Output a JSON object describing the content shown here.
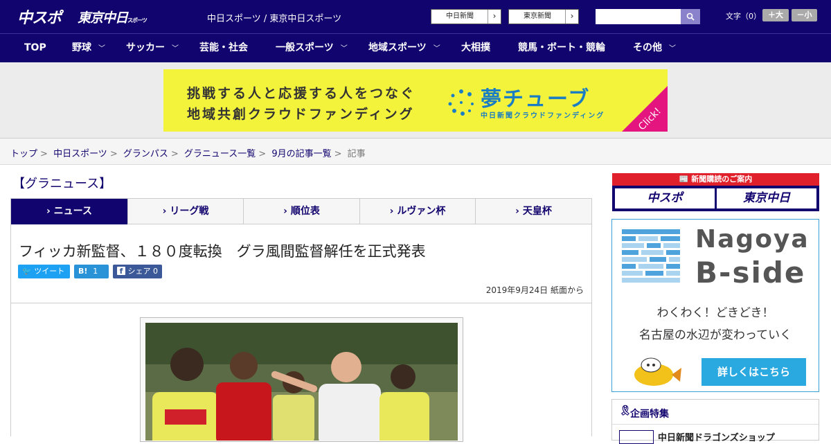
{
  "header": {
    "logo_main": "中スポ",
    "logo_tokyo": "東京中日",
    "logo_tokyo_small": "スポーツ",
    "site_names": "中日スポーツ / 東京中日スポーツ",
    "paper_buttons": [
      {
        "label": "中日新聞"
      },
      {
        "label": "東京新聞"
      }
    ],
    "search_placeholder": "",
    "font_size_label": "文字（0）",
    "font_increase": "＋大",
    "font_decrease": "－小"
  },
  "nav": {
    "items": [
      {
        "label": "TOP",
        "dropdown": false
      },
      {
        "label": "野球",
        "dropdown": true
      },
      {
        "label": "サッカー",
        "dropdown": true
      },
      {
        "label": "芸能・社会",
        "dropdown": false
      },
      {
        "label": "一般スポーツ",
        "dropdown": true
      },
      {
        "label": "地域スポーツ",
        "dropdown": true
      },
      {
        "label": "大相撲",
        "dropdown": false
      },
      {
        "label": "競馬・ボート・競輪",
        "dropdown": false
      },
      {
        "label": "その他",
        "dropdown": true
      }
    ]
  },
  "top_banner": {
    "line1": "挑戦する人と応援する人をつなぐ",
    "line2": "地域共創クラウドファンディング",
    "brand": "夢チューブ",
    "brand_sub": "中日新聞クラウドファンディング",
    "click": "Click!"
  },
  "breadcrumb": {
    "items": [
      "トップ",
      "中日スポーツ",
      "グランパス",
      "グラニュース一覧",
      "9月の記事一覧"
    ],
    "current": "記事"
  },
  "section_title": "【グラニュース】",
  "tabs": [
    {
      "label": "ニュース",
      "active": true
    },
    {
      "label": "リーグ戦",
      "active": false
    },
    {
      "label": "順位表",
      "active": false
    },
    {
      "label": "ルヴァン杯",
      "active": false
    },
    {
      "label": "天皇杯",
      "active": false
    }
  ],
  "article": {
    "headline": "フィッカ新監督、１８０度転換　グラ風間監督解任を正式発表",
    "share": {
      "tweet": "ツイート",
      "hatena_count": "1",
      "facebook": "シェア 0"
    },
    "date": "2019年9月24日 紙面から"
  },
  "sidebar": {
    "subscribe_header": "新聞購読のご案内",
    "subscribe_buttons": [
      "中スポ",
      "東京中日"
    ],
    "ad": {
      "title1": "Nagoya",
      "title2": "B-side",
      "copy1": "わくわく！どきどき！",
      "copy2": "名古屋の水辺が変わっていく",
      "button": "詳しくはこちら"
    },
    "feature": {
      "title": "企画特集",
      "item": "中日新聞ドラゴンズショップ"
    }
  },
  "colors": {
    "navy": "#12046e",
    "accent_red": "#e0202a",
    "banner_yellow": "#f4f33c",
    "ad_blue": "#2aa8e0"
  }
}
